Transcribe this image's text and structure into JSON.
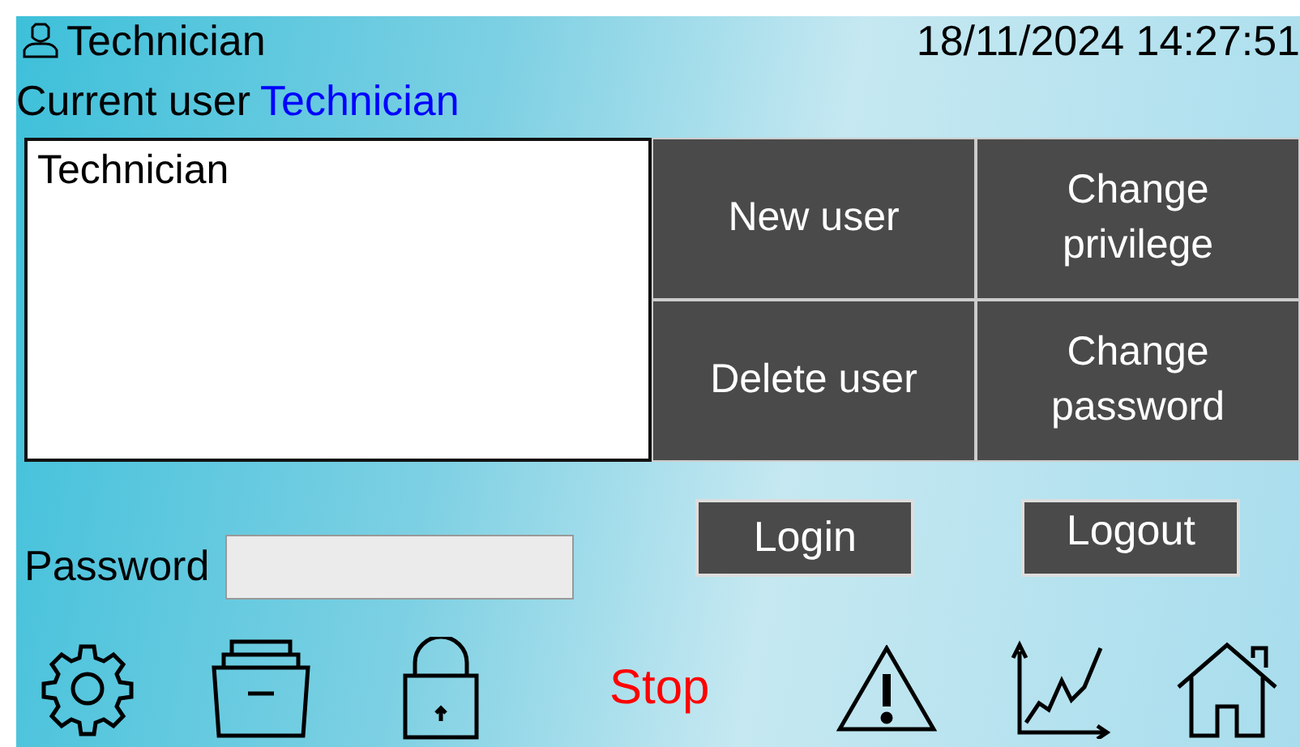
{
  "header": {
    "user": "Technician",
    "datetime": "18/11/2024 14:27:51"
  },
  "current_user": {
    "label": "Current user",
    "value": "Technician"
  },
  "user_list": {
    "items": [
      {
        "name": "Technician",
        "selected": false
      }
    ]
  },
  "actions": [
    {
      "label": "New user"
    },
    {
      "label": "Change privilege"
    },
    {
      "label": "Delete user"
    },
    {
      "label": "Change password"
    }
  ],
  "password": {
    "label": "Password"
  },
  "login_buttons": [
    {
      "label": "Login"
    },
    {
      "label": "Logout"
    }
  ],
  "toolbar": {
    "status": "Stop"
  }
}
